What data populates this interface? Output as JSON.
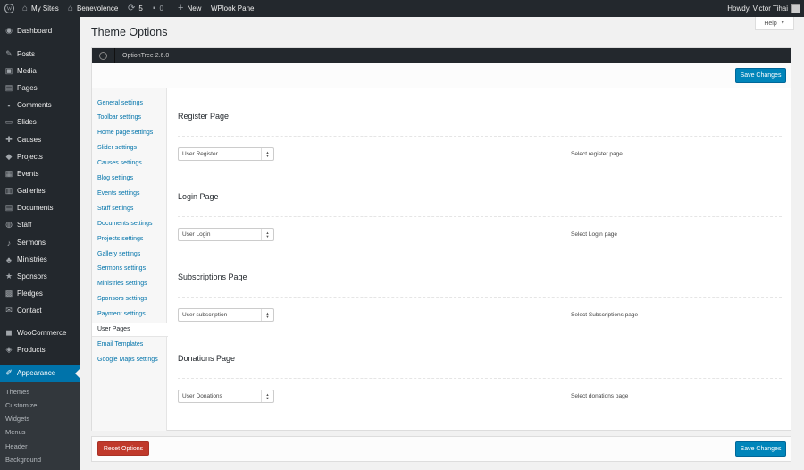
{
  "adminbar": {
    "my_sites": "My Sites",
    "site_name": "Benevolence",
    "updates_count": "5",
    "comments_count": "0",
    "new_label": "New",
    "panel_label": "WPlook Panel",
    "howdy": "Howdy, Victor Tihai"
  },
  "sidebar": {
    "items": [
      {
        "label": "Dashboard",
        "icon": "dashboard-icon"
      },
      {
        "label": "Posts",
        "icon": "pin-icon"
      },
      {
        "label": "Media",
        "icon": "media-icon"
      },
      {
        "label": "Pages",
        "icon": "pages-icon"
      },
      {
        "label": "Comments",
        "icon": "comments-icon"
      },
      {
        "label": "Slides",
        "icon": "slides-icon"
      },
      {
        "label": "Causes",
        "icon": "causes-icon"
      },
      {
        "label": "Projects",
        "icon": "projects-icon"
      },
      {
        "label": "Events",
        "icon": "events-icon"
      },
      {
        "label": "Galleries",
        "icon": "galleries-icon"
      },
      {
        "label": "Documents",
        "icon": "documents-icon"
      },
      {
        "label": "Staff",
        "icon": "staff-icon"
      },
      {
        "label": "Sermons",
        "icon": "sermons-icon"
      },
      {
        "label": "Ministries",
        "icon": "ministries-icon"
      },
      {
        "label": "Sponsors",
        "icon": "sponsors-icon"
      },
      {
        "label": "Pledges",
        "icon": "pledges-icon"
      },
      {
        "label": "Contact",
        "icon": "mail-icon"
      },
      {
        "label": "WooCommerce",
        "icon": "woocommerce-icon"
      },
      {
        "label": "Products",
        "icon": "products-icon"
      },
      {
        "label": "Appearance",
        "icon": "appearance-icon"
      }
    ],
    "submenu": [
      "Themes",
      "Customize",
      "Widgets",
      "Menus",
      "Header",
      "Background"
    ]
  },
  "header": {
    "title": "Theme Options",
    "help": "Help"
  },
  "optiontree": {
    "version": "OptionTree 2.6.0",
    "save_label": "Save Changes",
    "reset_label": "Reset Options",
    "nav": [
      "General settings",
      "Toolbar settings",
      "Home page settings",
      "Slider settings",
      "Causes settings",
      "Blog settings",
      "Events settings",
      "Staff settings",
      "Documents settings",
      "Projects settings",
      "Gallery settings",
      "Sermons settings",
      "Ministries settings",
      "Sponsors settings",
      "Payment settings",
      "User Pages",
      "Email Templates",
      "Google Maps settings"
    ],
    "active_nav": "User Pages",
    "sections": [
      {
        "title": "Register Page",
        "value": "User Register",
        "description": "Select register page"
      },
      {
        "title": "Login Page",
        "value": "User Login",
        "description": "Select Login page"
      },
      {
        "title": "Subscriptions Page",
        "value": "User subscription",
        "description": "Select Subscriptions page"
      },
      {
        "title": "Donations Page",
        "value": "User Donations",
        "description": "Select donations page"
      }
    ]
  },
  "colors": {
    "admin_dark": "#23282d",
    "accent_blue": "#0073aa",
    "button_blue": "#0085ba",
    "danger_red": "#c0392b"
  }
}
